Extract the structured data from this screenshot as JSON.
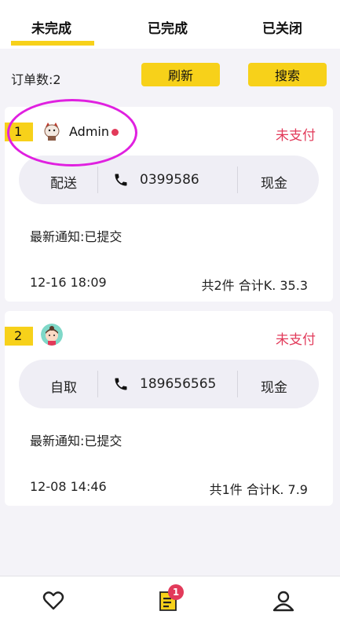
{
  "tabs": [
    {
      "label": "未完成"
    },
    {
      "label": "已完成"
    },
    {
      "label": "已关闭"
    }
  ],
  "toolbar": {
    "order_count": "订单数:2",
    "refresh_label": "刷新",
    "search_label": "搜索"
  },
  "orders": [
    {
      "index": "1",
      "username": "Admin",
      "pay_status": "未支付",
      "delivery_method": "配送",
      "phone": "0399586",
      "payment_method": "现金",
      "notice": "最新通知:已提交",
      "time": "12-16 18:09",
      "total": "共2件 合计K. 35.3"
    },
    {
      "index": "2",
      "username": "",
      "pay_status": "未支付",
      "delivery_method": "自取",
      "phone": "189656565",
      "payment_method": "现金",
      "notice": "最新通知:已提交",
      "time": "12-08 14:46",
      "total": "共1件 合计K. 7.9"
    }
  ],
  "bottom_nav": {
    "items": [
      "heart-icon",
      "orders-icon",
      "user-icon"
    ],
    "orders_badge": "1"
  },
  "colors": {
    "accent": "#f7d11a",
    "unpaid": "#e23a5a",
    "highlight": "#e020e0"
  }
}
